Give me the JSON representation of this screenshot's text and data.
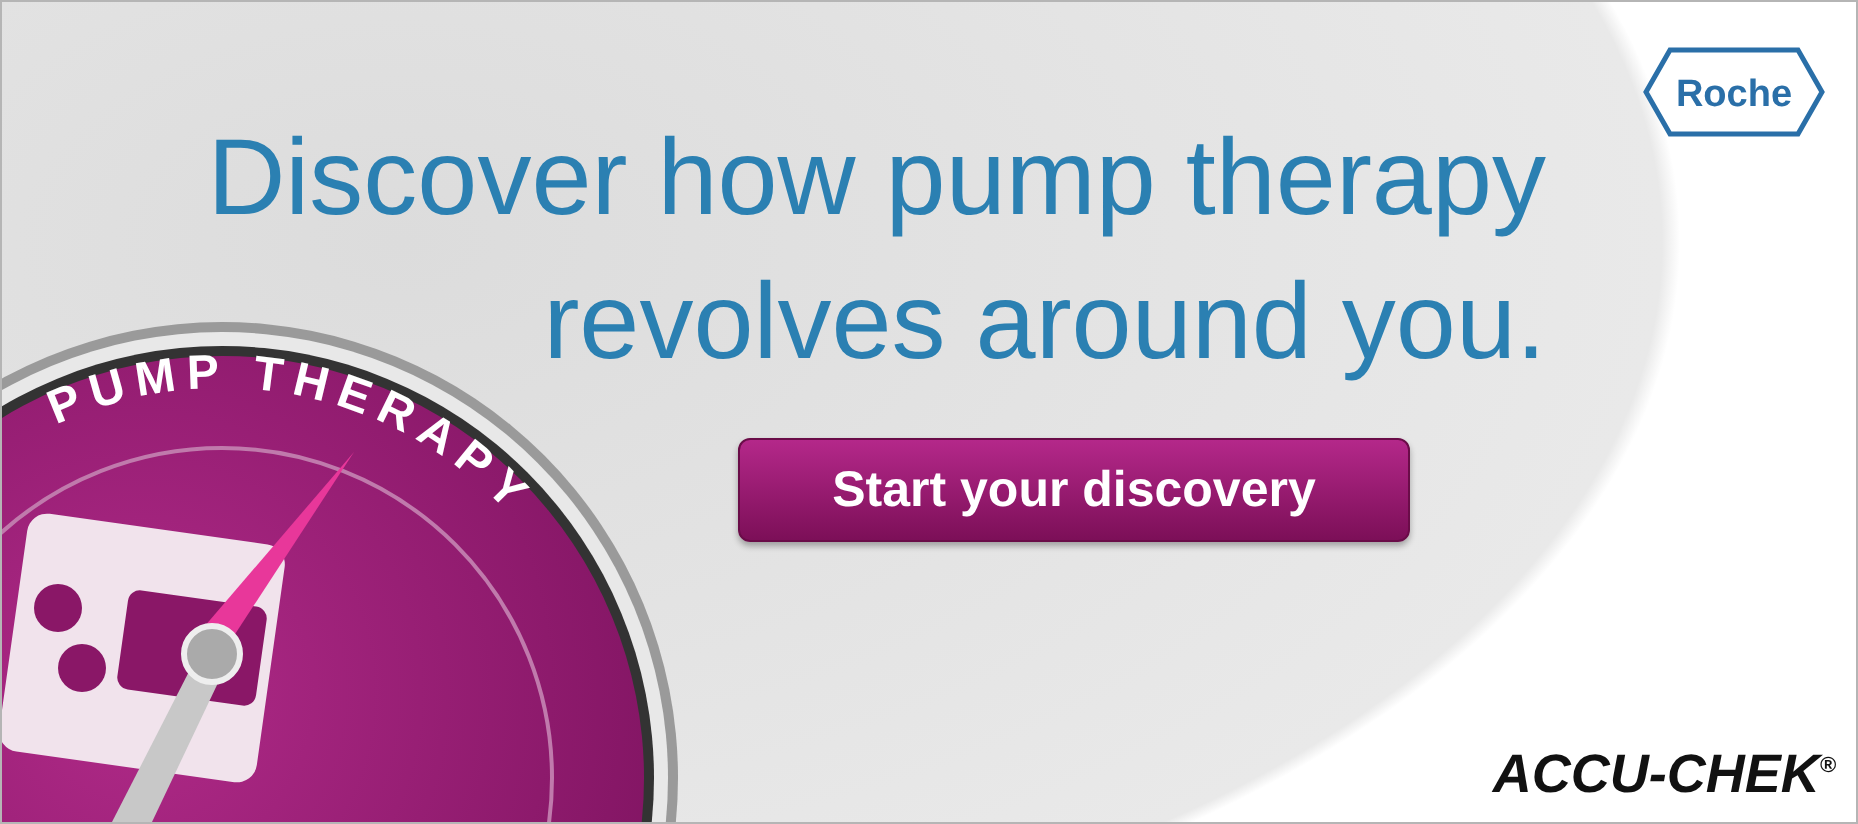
{
  "headline": [
    "Discover how pump therapy",
    "revolves around you."
  ],
  "button": "Start your discovery",
  "dial_label": "PUMP THERAPY",
  "logos": {
    "roche": "Roche",
    "accu_chek": "ACCU-CHEK$^{®}$"
  }
}
